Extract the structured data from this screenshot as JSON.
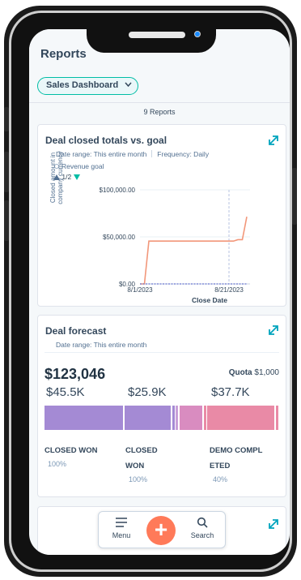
{
  "header": {
    "title": "Reports",
    "dashboard_selector": "Sales Dashboard",
    "report_count": "9 Reports"
  },
  "deal_closed_card": {
    "title": "Deal closed totals vs. goal",
    "date_range": "Date range: This entire month",
    "frequency": "Frequency: Daily",
    "legend_goal": "Revenue goal",
    "pager": "1/2",
    "chart_data": {
      "type": "line",
      "title": "Deal closed totals vs. goal",
      "xlabel": "Close Date",
      "ylabel": "Closed amount in company currency",
      "x_ticks": [
        "8/1/2023",
        "8/21/2023"
      ],
      "y_ticks": [
        "$100,000.00",
        "$50,000.00",
        "$0.00"
      ],
      "ylim": [
        0,
        100000
      ],
      "x": [
        "8/1/2023",
        "8/2/2023",
        "8/3/2023",
        "8/4/2023",
        "8/5/2023",
        "8/6/2023",
        "8/7/2023",
        "8/8/2023",
        "8/9/2023",
        "8/10/2023",
        "8/11/2023",
        "8/12/2023",
        "8/13/2023",
        "8/14/2023",
        "8/15/2023",
        "8/16/2023",
        "8/17/2023",
        "8/18/2023",
        "8/19/2023",
        "8/20/2023",
        "8/21/2023",
        "8/22/2023",
        "8/23/2023",
        "8/24/2023",
        "8/25/2023"
      ],
      "series": [
        {
          "name": "",
          "color": "#f2977a",
          "values": [
            0,
            0,
            45500,
            45500,
            45500,
            45500,
            45500,
            45500,
            45500,
            45500,
            45500,
            45500,
            45500,
            45500,
            45500,
            45500,
            45500,
            45500,
            45500,
            45500,
            45500,
            45500,
            47000,
            47000,
            71400
          ]
        },
        {
          "name": "Revenue goal",
          "color": "#6a78d1",
          "values": [
            0,
            0,
            0,
            0,
            0,
            0,
            0,
            0,
            0,
            0,
            0,
            0,
            0,
            0,
            0,
            0,
            0,
            0,
            0,
            0,
            0,
            0,
            0,
            0,
            0
          ]
        }
      ],
      "grid": true,
      "marker_date": "8/21/2023"
    }
  },
  "forecast_card": {
    "title": "Deal forecast",
    "date_range": "Date range: This entire month",
    "amount": "$123,046",
    "quota_label": "Quota",
    "quota_value": "$1,000",
    "segments": [
      {
        "value": "$45.5K",
        "label_line1": "CLOSED WON",
        "label_line2": "",
        "pct": "100%"
      },
      {
        "value": "$25.9K",
        "label_line1": "CLOSED",
        "label_line2": "WON",
        "pct": "100%"
      },
      {
        "value": "$37.7K",
        "label_line1": "DEMO COMPL",
        "label_line2": "ETED",
        "pct": "40%"
      }
    ],
    "bar_colors": {
      "purple": "#a48ad4",
      "pink": "#d98cc0",
      "rose": "#e98aa6"
    }
  },
  "nav": {
    "menu": "Menu",
    "search": "Search",
    "add": "+"
  },
  "colors": {
    "accent_teal": "#00bda5",
    "accent_orange": "#ff7a59",
    "text_dark": "#33475b"
  }
}
